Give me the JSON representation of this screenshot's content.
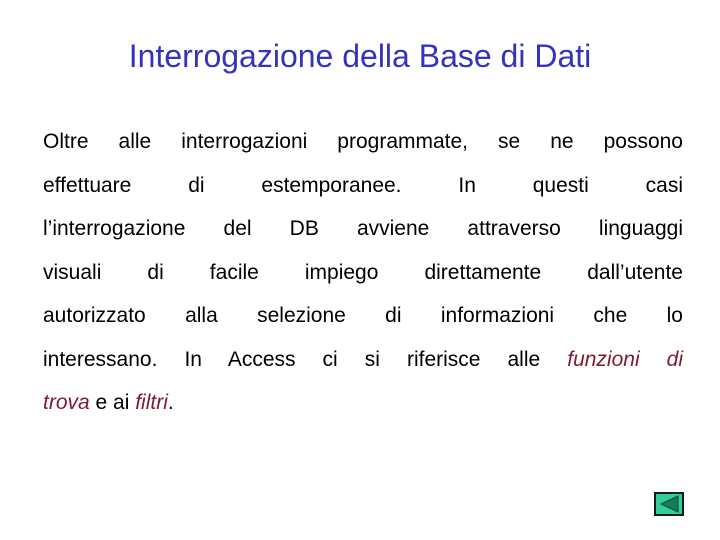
{
  "slide": {
    "title": "Interrogazione della Base di Dati",
    "lines": [
      "Oltre alle interrogazioni programmate, se ne possono",
      "effettuare di estemporanee. In questi casi",
      "l’interrogazione del DB avviene attraverso linguaggi",
      "visuali di facile impiego direttamente dall’utente",
      "autorizzato alla selezione di informazioni che lo"
    ],
    "line6_prefix": "interessano. In Access ci si riferisce alle ",
    "line6_emph": "funzioni di",
    "line7_emph1": "trova",
    "line7_mid": " e ai ",
    "line7_emph2": "filtri",
    "line7_end": ".",
    "emphasis_color": "#7f1a33",
    "title_color": "#3333bb"
  },
  "navigation": {
    "back_button_icon": "triangle-left-icon"
  }
}
